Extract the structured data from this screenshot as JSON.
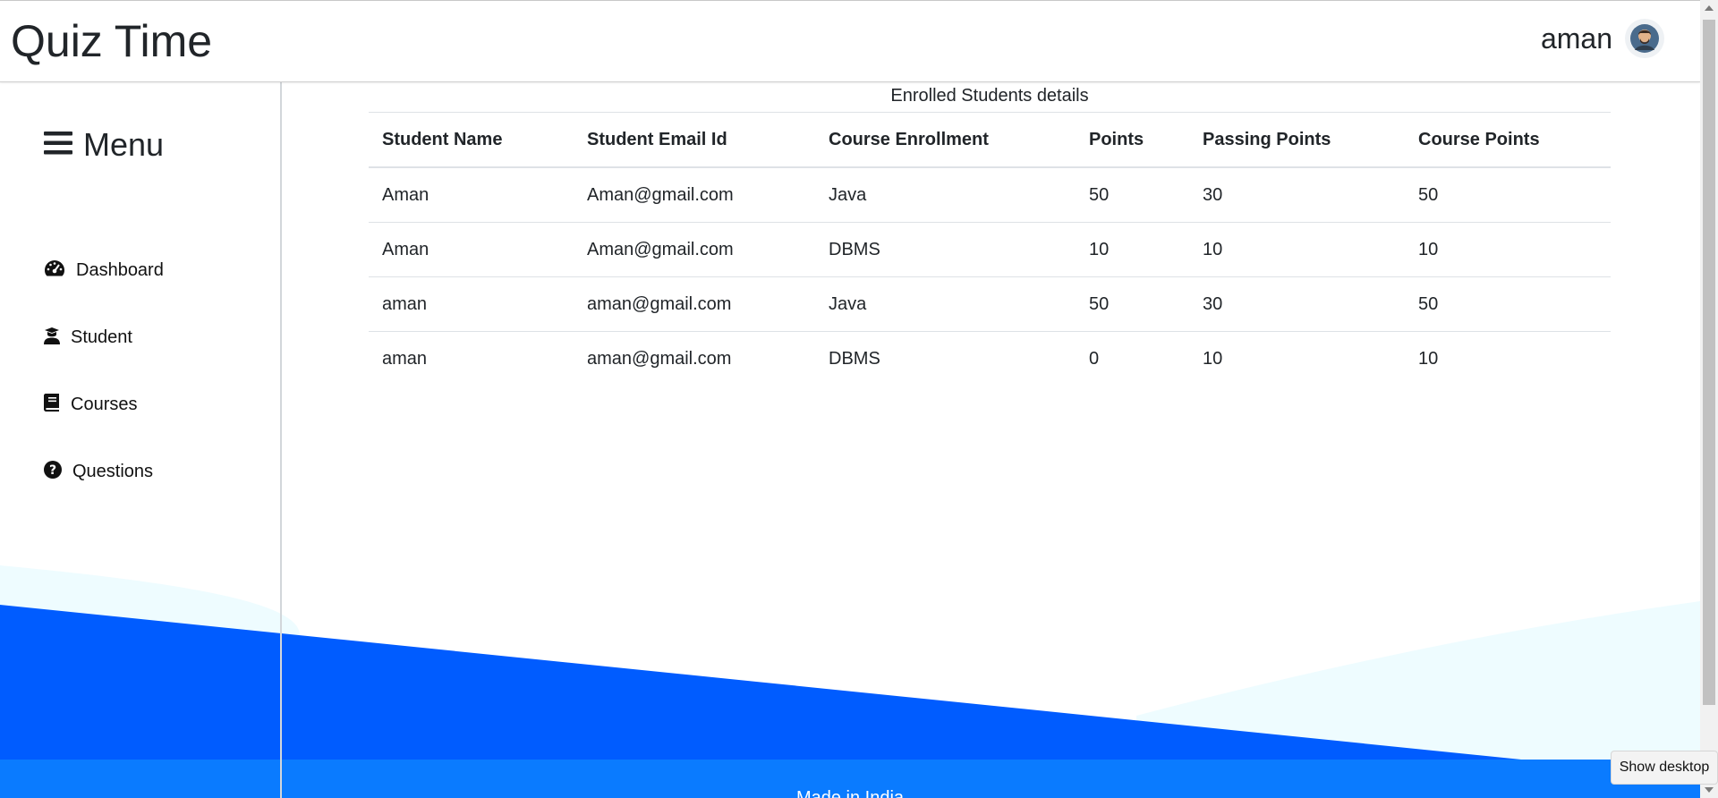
{
  "app": {
    "title": "Quiz Time"
  },
  "user": {
    "name": "aman",
    "avatar_icon": "user-avatar-icon"
  },
  "sidebar": {
    "menu_label": "Menu",
    "items": [
      {
        "label": "Dashboard",
        "icon": "dashboard-gauge-icon"
      },
      {
        "label": "Student",
        "icon": "graduate-student-icon"
      },
      {
        "label": "Courses",
        "icon": "book-icon"
      },
      {
        "label": "Questions",
        "icon": "question-circle-icon"
      }
    ]
  },
  "table": {
    "caption": "Enrolled Students details",
    "headers": [
      "Student Name",
      "Student Email Id",
      "Course Enrollment",
      "Points",
      "Passing Points",
      "Course Points"
    ],
    "rows": [
      [
        "Aman",
        "Aman@gmail.com",
        "Java",
        "50",
        "30",
        "50"
      ],
      [
        "Aman",
        "Aman@gmail.com",
        "DBMS",
        "10",
        "10",
        "10"
      ],
      [
        "aman",
        "aman@gmail.com",
        "Java",
        "50",
        "30",
        "50"
      ],
      [
        "aman",
        "aman@gmail.com",
        "DBMS",
        "0",
        "10",
        "10"
      ]
    ]
  },
  "footer": {
    "text": "Made in India"
  },
  "tooltip": {
    "text": "Show desktop"
  },
  "colors": {
    "wave_blue": "#005cff",
    "wave_light": "#eefcff",
    "footer_blue": "#0a7bff",
    "text": "#212529"
  }
}
